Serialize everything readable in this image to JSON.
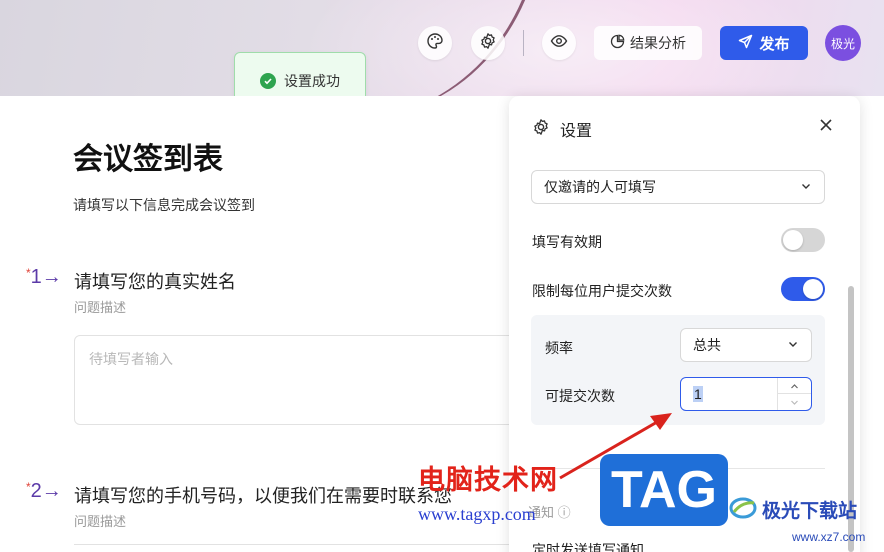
{
  "toolbar": {
    "result_label": "结果分析",
    "publish_label": "发布",
    "avatar_text": "极光"
  },
  "toast": {
    "message": "设置成功"
  },
  "form": {
    "title": "会议签到表",
    "description": "请填写以下信息完成会议签到",
    "questions": [
      {
        "number": "1",
        "title": "请填写您的真实姓名",
        "sub": "问题描述",
        "placeholder": "待填写者输入"
      },
      {
        "number": "2",
        "title": "请填写您的手机号码，以便我们在需要时联系您",
        "sub": "问题描述"
      }
    ]
  },
  "settings": {
    "title": "设置",
    "who_can_fill": "仅邀请的人可填写",
    "validity_label": "填写有效期",
    "validity_on": false,
    "limit_label": "限制每位用户提交次数",
    "limit_on": true,
    "frequency_label": "频率",
    "frequency_value": "总共",
    "submit_count_label": "可提交次数",
    "submit_count_value": "1",
    "bottom_label": "定时发送填写通知",
    "hint_text": "通知 ⓘ"
  },
  "watermark": {
    "text": "电脑技术网",
    "url": "www.tagxp.com",
    "tag": "TAG",
    "logo_name": "极光下载站",
    "logo_url": "www.xz7.com"
  },
  "colors": {
    "accent": "#2f5bea",
    "avatar": "#7b4fe0",
    "toast_bg": "#edfbef",
    "success": "#2ea44f",
    "required_star": "#e0453a",
    "question_number": "#5b3aa8"
  }
}
